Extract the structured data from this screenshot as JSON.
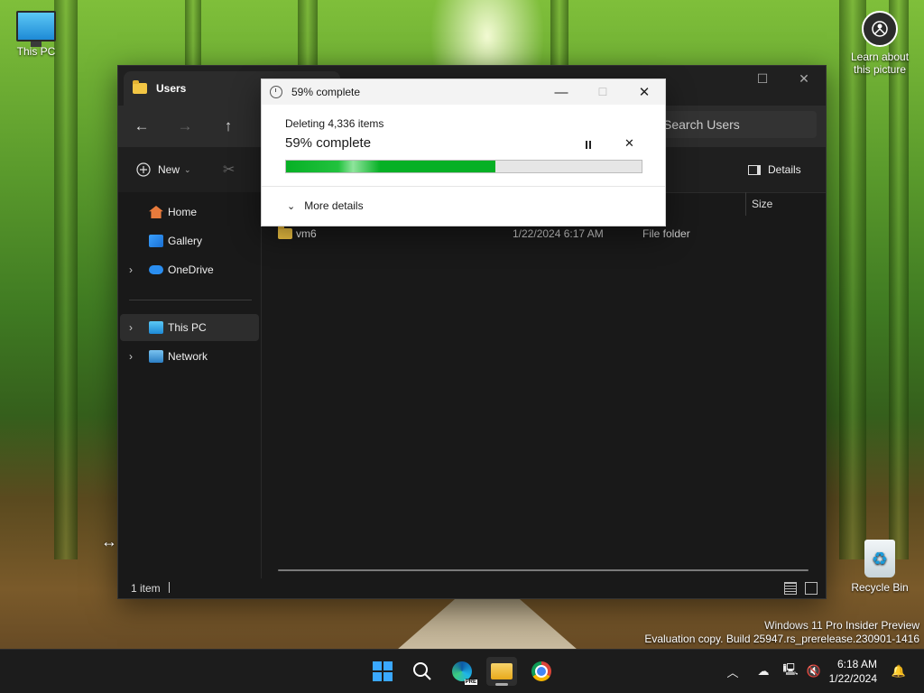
{
  "desktop": {
    "this_pc_label": "This PC",
    "learn_label_line1": "Learn about",
    "learn_label_line2": "this picture",
    "recycle_bin_label": "Recycle Bin",
    "watermark_line1": "Windows 11 Pro Insider Preview",
    "watermark_line2": "Evaluation copy. Build 25947.rs_prerelease.230901-1416"
  },
  "explorer": {
    "tab_title": "Users",
    "search_placeholder": "Search Users",
    "toolbar": {
      "new_label": "New",
      "details_label": "Details"
    },
    "sidebar": {
      "home": "Home",
      "gallery": "Gallery",
      "onedrive": "OneDrive",
      "this_pc": "This PC",
      "network": "Network"
    },
    "columns": {
      "size": "Size"
    },
    "rows": [
      {
        "name": "vm6",
        "date": "1/22/2024 6:17 AM",
        "type": "File folder"
      }
    ],
    "status": {
      "item_count": "1 item"
    }
  },
  "dialog": {
    "title": "59% complete",
    "operation": "Deleting 4,336 items",
    "percent_text": "59% complete",
    "progress": 0.59,
    "more_details": "More details"
  },
  "taskbar": {
    "time": "6:18 AM",
    "date": "1/22/2024",
    "edge_badge": "PRE"
  },
  "colors": {
    "progress_green": "#06b025",
    "explorer_bg": "#191919",
    "accent_blue": "#0078d4"
  }
}
